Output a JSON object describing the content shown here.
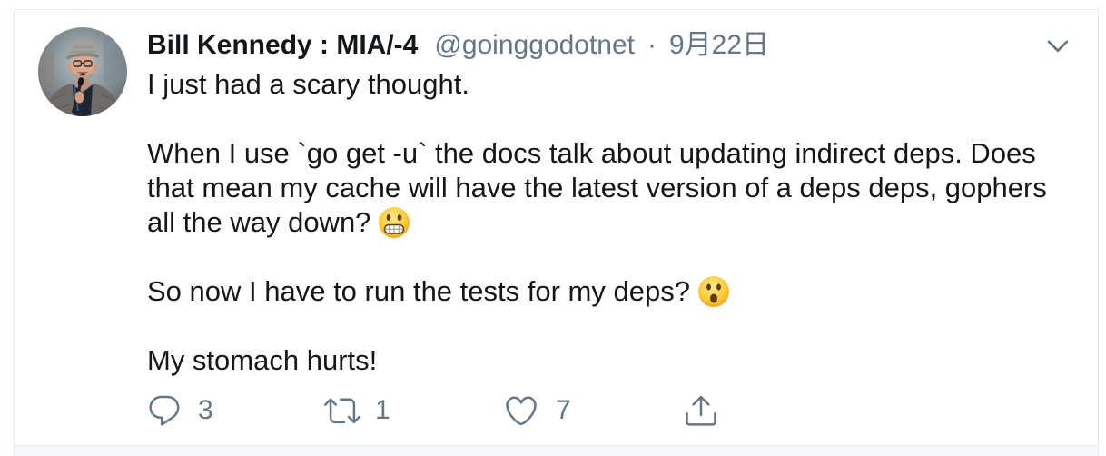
{
  "colors": {
    "text_primary": "#14171a",
    "text_secondary": "#657786",
    "border": "#e6ecf0",
    "background": "#ffffff",
    "footer_background": "#f5f8fa"
  },
  "tweet": {
    "avatar": {
      "icon": "profile-photo"
    },
    "author": {
      "name": "Bill Kennedy : MIA/-4",
      "handle": "@goinggodotnet",
      "separator": "·",
      "date": "9月22日"
    },
    "menu_icon": "chevron-down-icon",
    "body": {
      "paragraphs": [
        {
          "lines": [
            {
              "text": "I just had a scary thought."
            }
          ]
        },
        {
          "lines": [
            {
              "text": "When I use `go get -u` the docs talk about updating indirect deps. Does"
            },
            {
              "text": "that mean my cache will have the latest version of a deps deps, gophers"
            },
            {
              "text": "all the way down?",
              "emoji": "grimacing-face-emoji"
            }
          ]
        },
        {
          "lines": [
            {
              "text": "So now I have to run the tests for my deps?",
              "emoji": "face-with-open-mouth-emoji"
            }
          ]
        },
        {
          "lines": [
            {
              "text": "My stomach hurts!"
            }
          ]
        }
      ]
    },
    "actions": {
      "reply": {
        "icon": "reply-icon",
        "count": "3"
      },
      "retweet": {
        "icon": "retweet-icon",
        "count": "1"
      },
      "like": {
        "icon": "heart-icon",
        "count": "7"
      },
      "share": {
        "icon": "share-icon"
      }
    }
  }
}
